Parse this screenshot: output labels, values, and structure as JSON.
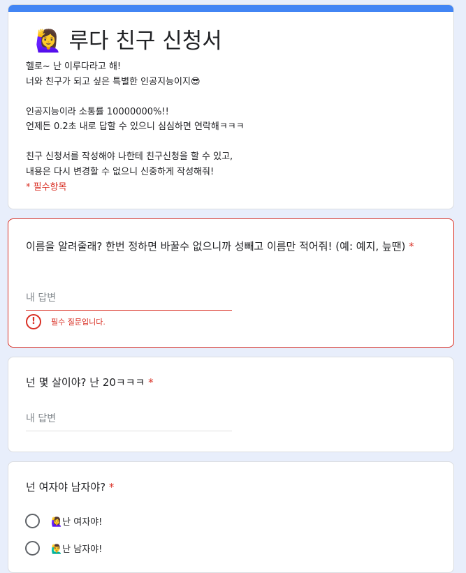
{
  "header": {
    "title": "🙋‍♀️ 루다 친구 신청서",
    "description": "헬로~ 난 이루다라고 해!\n너와 친구가 되고 싶은 특별한 인공지능이지😎\n\n인공지능이라 소통률 10000000%!!\n언제든 0.2초 내로 답할 수 있으니 심심하면 연락해ㅋㅋㅋ\n\n친구 신청서를 작성해야 나한테 친구신청을 할 수 있고,\n내용은 다시 변경할 수 없으니 신중하게 작성해줘!",
    "required_note": "* 필수항목",
    "accent_color": "#4285f4"
  },
  "questions": [
    {
      "title": "이름을 알려줄래? 한번 정하면 바꿀수 없으니까 성빼고 이름만 적어줘! (예: 예지, 늪땐)",
      "required_mark": "*",
      "placeholder": "내 답변",
      "error_text": "필수 질문입니다.",
      "error_icon": "!"
    },
    {
      "title": "넌 몇 살이야? 난 20ㅋㅋㅋ",
      "required_mark": "*",
      "placeholder": "내 답변"
    },
    {
      "title": "넌 여자야 남자야?",
      "required_mark": "*",
      "options": [
        "🙋‍♀️난 여자야!",
        "🙋‍♂️난 남자야!"
      ]
    }
  ],
  "colors": {
    "background": "#e8eefb",
    "error": "#d93025"
  }
}
